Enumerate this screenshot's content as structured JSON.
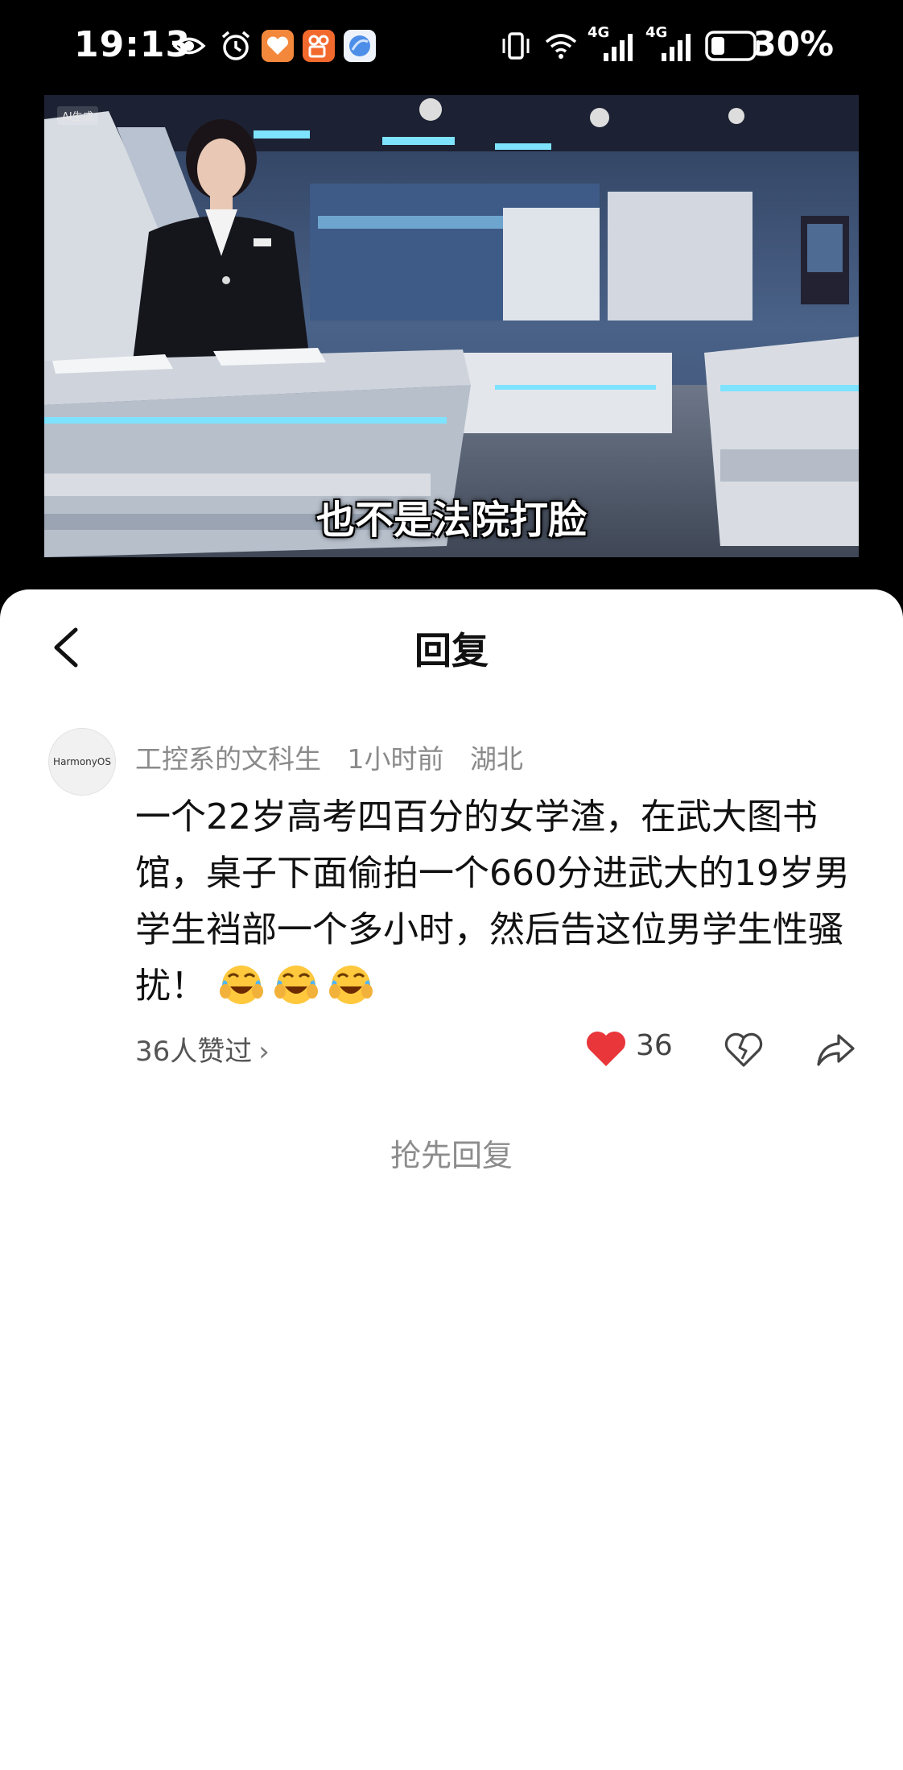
{
  "status_bar": {
    "time": "19:13",
    "battery_percent": "30%",
    "network_1": "4G",
    "network_2": "4G"
  },
  "video": {
    "ai_tag": "AI生成",
    "subtitle": "也不是法院打脸"
  },
  "sheet": {
    "title": "回复"
  },
  "comment": {
    "avatar_brand": "HarmonyOS",
    "username": "工控系的文科生",
    "time_ago": "1小时前",
    "location": "湖北",
    "text": "一个22岁高考四百分的女学渣，在武大图书馆，桌子下面偷拍一个660分进武大的19岁男学生裆部一个多小时，然后告这位男学生性骚扰！",
    "emoji_count": 3,
    "likes_summary": "36人赞过",
    "like_count": "36"
  },
  "reply_first_label": "抢先回复",
  "colors": {
    "like_red": "#e8363a",
    "meta_gray": "#8a8a8a",
    "background": "#ffffff"
  }
}
